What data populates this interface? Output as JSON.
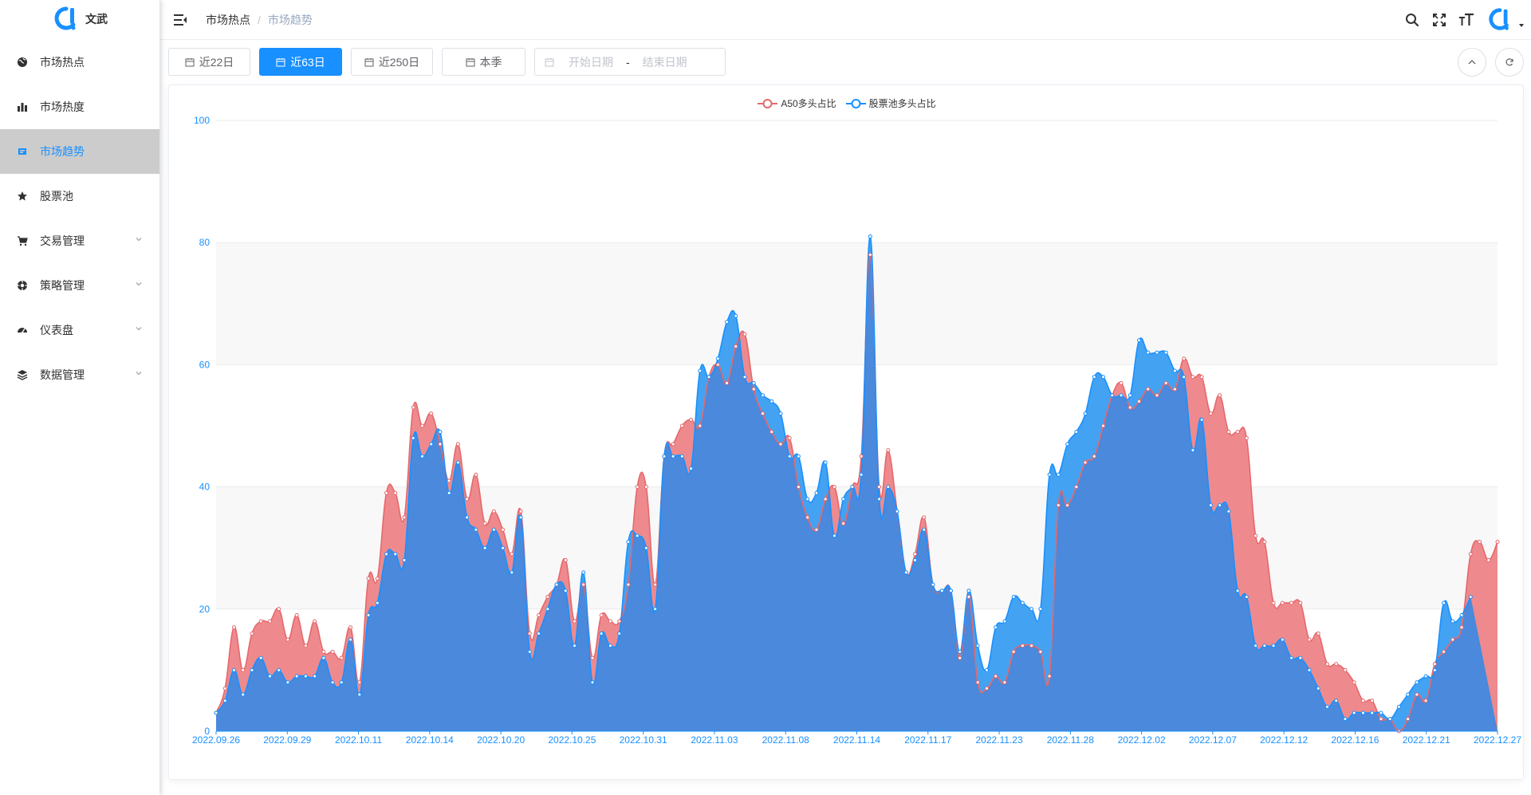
{
  "app": {
    "logo_text": "文武",
    "brand_color": "#1890ff"
  },
  "sidebar": {
    "items": [
      {
        "label": "市场热点",
        "icon": "globe-icon",
        "active": false,
        "has_children": false
      },
      {
        "label": "市场热度",
        "icon": "bar-chart-icon",
        "active": false,
        "has_children": false
      },
      {
        "label": "市场趋势",
        "icon": "trend-icon",
        "active": true,
        "has_children": false
      },
      {
        "label": "股票池",
        "icon": "star-icon",
        "active": false,
        "has_children": false
      },
      {
        "label": "交易管理",
        "icon": "cart-icon",
        "active": false,
        "has_children": true
      },
      {
        "label": "策略管理",
        "icon": "compass-icon",
        "active": false,
        "has_children": true
      },
      {
        "label": "仪表盘",
        "icon": "dashboard-icon",
        "active": false,
        "has_children": true
      },
      {
        "label": "数据管理",
        "icon": "database-icon",
        "active": false,
        "has_children": true
      }
    ]
  },
  "header": {
    "breadcrumb": [
      "市场热点",
      "市场趋势"
    ],
    "icons": [
      "search-icon",
      "fullscreen-icon",
      "font-size-icon",
      "avatar"
    ]
  },
  "toolbar": {
    "buttons": [
      {
        "label": "近22日",
        "active": false
      },
      {
        "label": "近63日",
        "active": true
      },
      {
        "label": "近250日",
        "active": false
      },
      {
        "label": "本季",
        "active": false
      }
    ],
    "date_range": {
      "start_placeholder": "开始日期",
      "separator": "-",
      "end_placeholder": "结束日期"
    }
  },
  "chart_data": {
    "type": "area",
    "title": "",
    "xlabel": "",
    "ylabel": "",
    "ylim": [
      0,
      100
    ],
    "yticks": [
      0,
      20,
      40,
      60,
      80,
      100
    ],
    "grid": true,
    "legend_position": "top-center",
    "x_tick_labels": [
      "2022.09.26",
      "2022.09.29",
      "2022.10.11",
      "2022.10.14",
      "2022.10.20",
      "2022.10.25",
      "2022.10.31",
      "2022.11.03",
      "2022.11.08",
      "2022.11.14",
      "2022.11.17",
      "2022.11.23",
      "2022.11.28",
      "2022.12.02",
      "2022.12.07",
      "2022.12.12",
      "2022.12.16",
      "2022.12.21",
      "2022.12.27"
    ],
    "series": [
      {
        "name": "A50多头占比",
        "color": "#e5686c",
        "fill": "#ee8a8d",
        "values": [
          3,
          7,
          17,
          10,
          16,
          18,
          18,
          20,
          15,
          19,
          14,
          18,
          13,
          13,
          12,
          17,
          8,
          25,
          25,
          39,
          39,
          35,
          53,
          50,
          52,
          47,
          41,
          47,
          38,
          42,
          34,
          36,
          33,
          29,
          36,
          16,
          19,
          22,
          24,
          28,
          18,
          24,
          12,
          19,
          18,
          18,
          24,
          40,
          40,
          24,
          45,
          47,
          50,
          51,
          50,
          58,
          60,
          57,
          63,
          65,
          56,
          52,
          49,
          47,
          48,
          40,
          35,
          33,
          38,
          40,
          34,
          40,
          45,
          78,
          40,
          46,
          36,
          26,
          29,
          35,
          24,
          23,
          23,
          12,
          22,
          8,
          7,
          9,
          8,
          13,
          14,
          14,
          13,
          9,
          37,
          37,
          40,
          44,
          45,
          50,
          55,
          57,
          53,
          54,
          56,
          55,
          57,
          56,
          61,
          58,
          58,
          52,
          55,
          49,
          49,
          48,
          32,
          31,
          21,
          21,
          21,
          21,
          15,
          16,
          11,
          11,
          10,
          8,
          5,
          5,
          2,
          2,
          0,
          2,
          6,
          5,
          11,
          13,
          15,
          17,
          29,
          31,
          28,
          31
        ]
      },
      {
        "name": "股票池多头占比",
        "color": "#1890ff",
        "fill": "#44a2f2",
        "values": [
          3,
          5,
          10,
          6,
          10,
          12,
          9,
          10,
          8,
          9,
          9,
          9,
          12,
          8,
          8,
          15,
          6,
          19,
          21,
          29,
          29,
          28,
          48,
          45,
          47,
          49,
          39,
          44,
          35,
          33,
          30,
          33,
          30,
          26,
          35,
          13,
          16,
          20,
          24,
          23,
          14,
          26,
          8,
          16,
          14,
          16,
          31,
          32,
          30,
          20,
          45,
          45,
          45,
          43,
          59,
          58,
          61,
          67,
          68,
          58,
          57,
          55,
          54,
          52,
          45,
          45,
          38,
          39,
          44,
          32,
          38,
          40,
          42,
          81,
          38,
          40,
          36,
          26,
          28,
          33,
          24,
          23,
          23,
          13,
          23,
          14,
          10,
          17,
          18,
          22,
          21,
          20,
          20,
          42,
          42,
          47,
          49,
          52,
          58,
          58,
          55,
          55,
          55,
          64,
          62,
          62,
          62,
          59,
          58,
          46,
          51,
          37,
          37,
          36,
          23,
          22,
          14,
          14,
          14,
          15,
          12,
          12,
          10,
          7,
          4,
          5,
          2,
          3,
          3,
          3,
          3,
          2,
          4,
          6,
          8,
          9,
          10,
          21,
          18,
          19,
          22
        ]
      }
    ]
  }
}
